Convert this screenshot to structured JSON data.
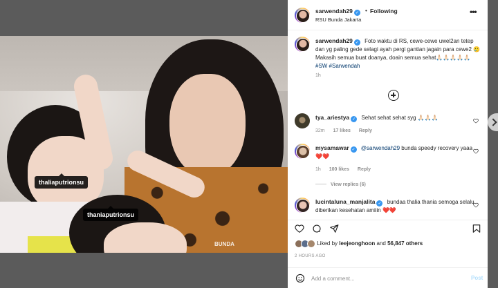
{
  "post": {
    "tag_1": "thaliaputrionsu",
    "tag_2": "thaniaputrionsu",
    "watermark": "BUNDA"
  },
  "header": {
    "username": "sarwendah29",
    "separator": "•",
    "follow_status": "Following",
    "location": "RSU Bunda Jakarta",
    "more": "•••"
  },
  "caption": {
    "username": "sarwendah29",
    "text": "Foto waktu di RS, cewe-cewe uwel2an tetep dan yg paling gede selagi ayah pergi gantian jagain para cewe2 🥲 Makasih semua buat doanya, doain semua sehat🙏🏻🙏🏻🙏🏻🙏🏻🙏🏻",
    "hashtags": "#SW #Sarwendah",
    "ago": "1h"
  },
  "comments": [
    {
      "username": "tya_ariestya",
      "text": "Sehat sehat sehat syg 🙏🏻🙏🏻🙏🏻",
      "ago": "32m",
      "likes": "17 likes",
      "reply": "Reply"
    },
    {
      "username": "mysamawar",
      "mention": "@sarwendah29",
      "text": "bunda speedy recovery yaaa ❤️❤️",
      "ago": "1h",
      "likes": "100 likes",
      "reply": "Reply",
      "view_replies": "View replies (6)"
    },
    {
      "username": "lucintaluna_manjalita",
      "text": "bundaa thalia thania semoga selalu diberikan kesehatan amiiin ❤️❤️"
    }
  ],
  "likes": {
    "prefix": "Liked by",
    "user": "leejeonghoon",
    "and": "and",
    "others": "56,847 others"
  },
  "timestamp": "2 HOURS AGO",
  "add_comment": {
    "placeholder": "Add a comment...",
    "post_label": "Post"
  },
  "colors": {
    "link": "#00376b",
    "verified": "#3897f0",
    "post_disabled": "#b2dffc"
  }
}
